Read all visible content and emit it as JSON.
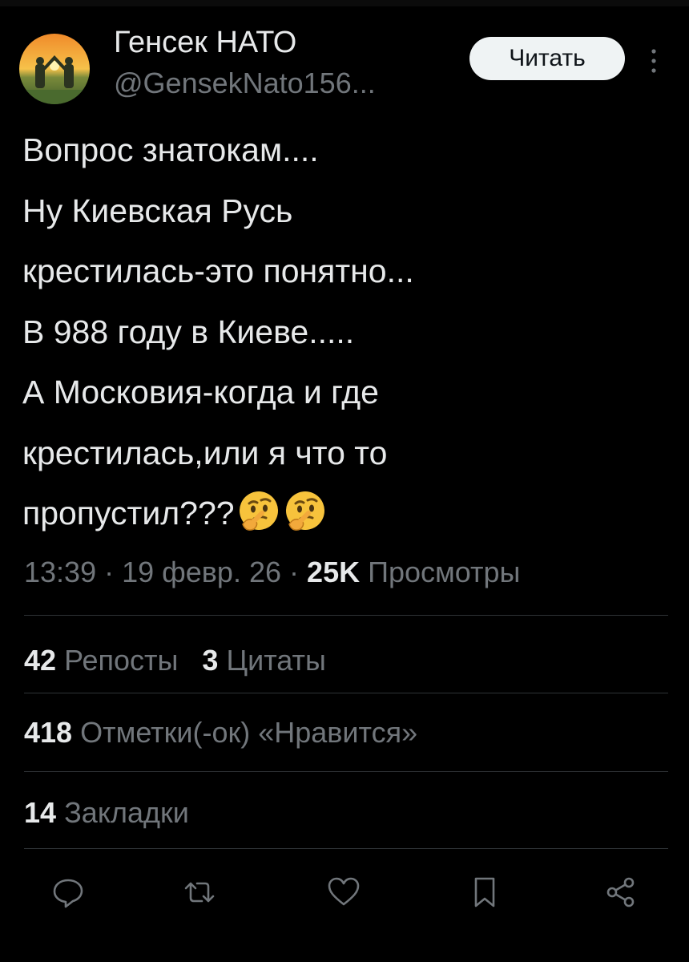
{
  "user": {
    "name": "Генсек НАТО",
    "handle": "@GensekNato156..."
  },
  "follow_button": {
    "label": "Читать"
  },
  "tweet": {
    "lines": [
      "Вопрос знатокам....",
      "Ну Киевская Русь",
      "крестилась-это понятно...",
      "В 988 году в Киеве.....",
      "А Московия-когда и где",
      "крестилась,или я что то",
      "пропустил???"
    ],
    "emoji": [
      "thinking-face-icon",
      "thinking-face-icon"
    ]
  },
  "meta": {
    "time": "13:39",
    "separator": "·",
    "date": "19 февр. 26",
    "views_count": "25K",
    "views_label": "Просмотры"
  },
  "stats": {
    "reposts_count": "42",
    "reposts_label": "Репосты",
    "quotes_count": "3",
    "quotes_label": "Цитаты",
    "likes_count": "418",
    "likes_label": "Отметки(-ок) «Нравится»",
    "bookmarks_count": "14",
    "bookmarks_label": "Закладки"
  },
  "actions": [
    "reply-icon",
    "repost-icon",
    "like-icon",
    "bookmark-icon",
    "share-icon"
  ],
  "colors": {
    "background": "#000000",
    "text": "#e7e9ea",
    "secondary": "#71767b",
    "divider": "#2f3336",
    "button_bg": "#eff3f4"
  }
}
